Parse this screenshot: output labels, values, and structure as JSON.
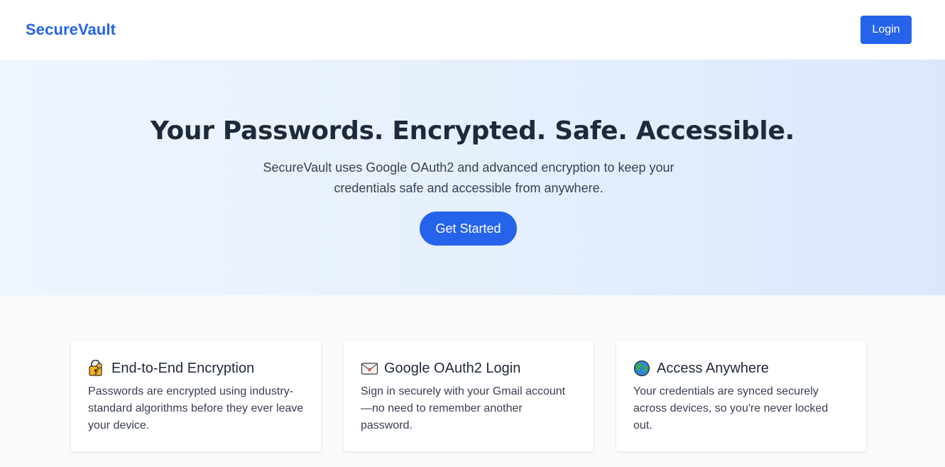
{
  "nav": {
    "brand": "SecureVault",
    "login_label": "Login"
  },
  "hero": {
    "title": "Your Passwords. Encrypted. Safe. Accessible.",
    "subtitle": "SecureVault uses Google OAuth2 and advanced encryption to keep your credentials safe and accessible from anywhere.",
    "cta_label": "Get Started"
  },
  "features": [
    {
      "icon": "lock-key-icon",
      "title": "End-to-End Encryption",
      "text": "Passwords are encrypted using industry-standard algorithms before they ever leave your device."
    },
    {
      "icon": "envelope-icon",
      "title": "Google OAuth2 Login",
      "text": "Sign in securely with your Gmail account—no need to remember another password."
    },
    {
      "icon": "globe-icon",
      "title": "Access Anywhere",
      "text": "Your credentials are synced securely across devices, so you're never locked out."
    }
  ],
  "colors": {
    "accent": "#2563eb",
    "heading": "#1e293b",
    "body_text": "#374151",
    "hero_bg_start": "#eef5fe",
    "hero_bg_end": "#dbe8fc",
    "page_bg": "#f8fafc"
  }
}
